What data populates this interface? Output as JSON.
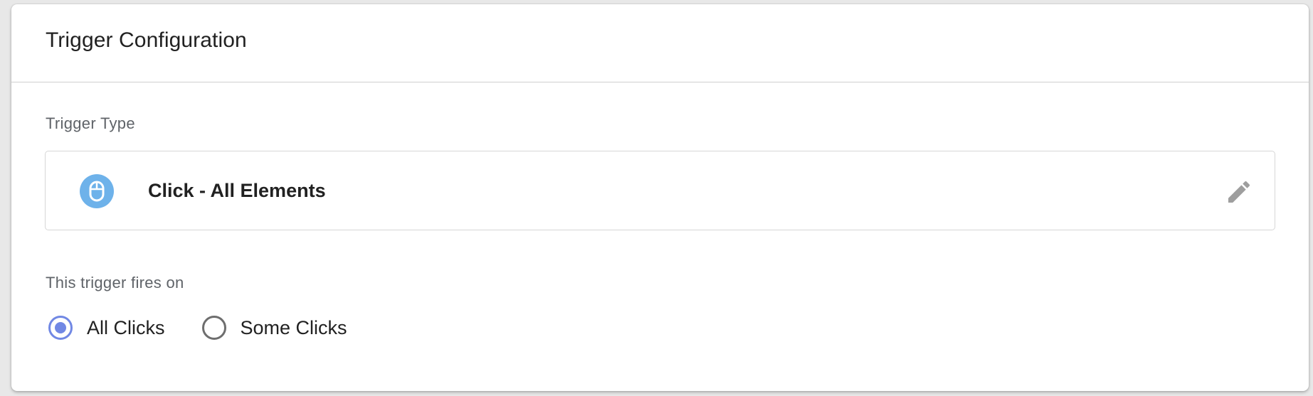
{
  "card": {
    "title": "Trigger Configuration"
  },
  "trigger_type": {
    "label": "Trigger Type",
    "selected_name": "Click - All Elements",
    "icon": "mouse-icon",
    "icon_color": "#6eb2ea",
    "edit_icon": "pencil-icon"
  },
  "fires_on": {
    "label": "This trigger fires on",
    "options": [
      {
        "label": "All Clicks",
        "selected": true
      },
      {
        "label": "Some Clicks",
        "selected": false
      }
    ],
    "accent_color": "#7188e4"
  }
}
